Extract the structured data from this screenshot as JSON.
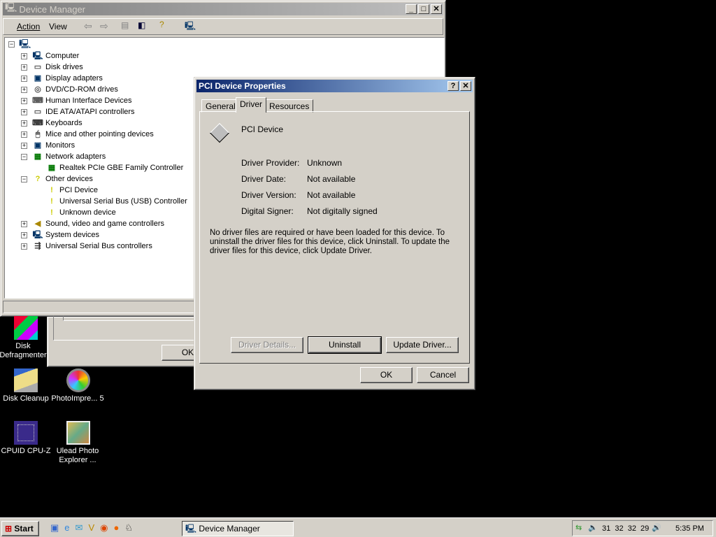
{
  "device_manager": {
    "title": "Device Manager",
    "menu": [
      "Action",
      "View"
    ],
    "tree": [
      {
        "label": "Computer",
        "icon": "computer-icon",
        "expanded": false
      },
      {
        "label": "Disk drives",
        "icon": "disk-icon",
        "expanded": false
      },
      {
        "label": "Display adapters",
        "icon": "display-icon",
        "expanded": false
      },
      {
        "label": "DVD/CD-ROM drives",
        "icon": "cdrom-icon",
        "expanded": false
      },
      {
        "label": "Human Interface Devices",
        "icon": "hid-icon",
        "expanded": false
      },
      {
        "label": "IDE ATA/ATAPI controllers",
        "icon": "ide-icon",
        "expanded": false
      },
      {
        "label": "Keyboards",
        "icon": "keyboard-icon",
        "expanded": false
      },
      {
        "label": "Mice and other pointing devices",
        "icon": "mouse-icon",
        "expanded": false
      },
      {
        "label": "Monitors",
        "icon": "monitor-icon",
        "expanded": false
      },
      {
        "label": "Network adapters",
        "icon": "network-icon",
        "expanded": true
      },
      {
        "label": "Realtek PCIe GBE Family Controller",
        "icon": "nic-icon",
        "child": true
      },
      {
        "label": "Other devices",
        "icon": "question-icon",
        "expanded": true
      },
      {
        "label": "PCI Device",
        "icon": "warning-icon",
        "child": true
      },
      {
        "label": "Universal Serial Bus (USB) Controller",
        "icon": "warning-icon",
        "child": true
      },
      {
        "label": "Unknown device",
        "icon": "warning-icon",
        "child": true
      },
      {
        "label": "Sound, video and game controllers",
        "icon": "sound-icon",
        "expanded": false
      },
      {
        "label": "System devices",
        "icon": "system-icon",
        "expanded": false
      },
      {
        "label": "Universal Serial Bus controllers",
        "icon": "usb-icon",
        "expanded": false
      }
    ]
  },
  "background_window": {
    "ok": "OK"
  },
  "dialog": {
    "title": "PCI Device Properties",
    "tabs": [
      "General",
      "Driver",
      "Resources"
    ],
    "active_tab": "Driver",
    "device_name": "PCI Device",
    "fields": [
      {
        "k": "Driver Provider:",
        "v": "Unknown"
      },
      {
        "k": "Driver Date:",
        "v": "Not available"
      },
      {
        "k": "Driver Version:",
        "v": "Not available"
      },
      {
        "k": "Digital Signer:",
        "v": "Not digitally signed"
      }
    ],
    "description": "No driver files are required or have been loaded for this device. To uninstall the driver files for this device, click Uninstall. To update the driver files for this device, click Update Driver.",
    "buttons": {
      "details": "Driver Details...",
      "uninstall": "Uninstall",
      "update": "Update Driver...",
      "ok": "OK",
      "cancel": "Cancel"
    }
  },
  "desktop": [
    {
      "label": "Disk Defragmenter"
    },
    {
      "label": "Disk Cleanup"
    },
    {
      "label": "PhotoImpre... 5"
    },
    {
      "label": "CPUID CPU-Z"
    },
    {
      "label": "Ulead Photo Explorer ..."
    }
  ],
  "taskbar": {
    "start": "Start",
    "task": "Device Manager",
    "tray_numbers": "31  32  32  29",
    "clock": "5:35 PM"
  }
}
